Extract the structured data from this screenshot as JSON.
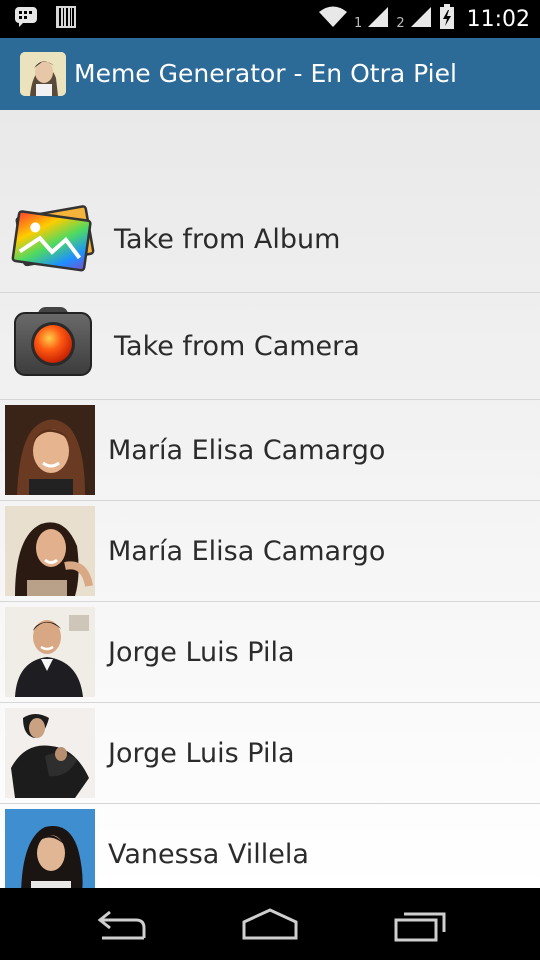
{
  "status_bar": {
    "time": "11:02",
    "sim1": "1",
    "sim2": "2",
    "icons": [
      "bbm-icon",
      "barcode-icon",
      "wifi-icon",
      "signal-icon",
      "signal-icon",
      "battery-charging-icon"
    ]
  },
  "action_bar": {
    "title": "Meme Generator - En Otra Piel",
    "color": "#2c6a98"
  },
  "list": {
    "actions": [
      {
        "label": "Take from Album",
        "icon": "photo-album-icon"
      },
      {
        "label": "Take from Camera",
        "icon": "camera-icon"
      }
    ],
    "people": [
      {
        "name": "María Elisa Camargo"
      },
      {
        "name": "María Elisa Camargo"
      },
      {
        "name": "Jorge Luis Pila"
      },
      {
        "name": "Jorge Luis Pila"
      },
      {
        "name": "Vanessa Villela"
      }
    ]
  },
  "nav_bar": {
    "buttons": [
      "back",
      "home",
      "recent-apps"
    ]
  }
}
